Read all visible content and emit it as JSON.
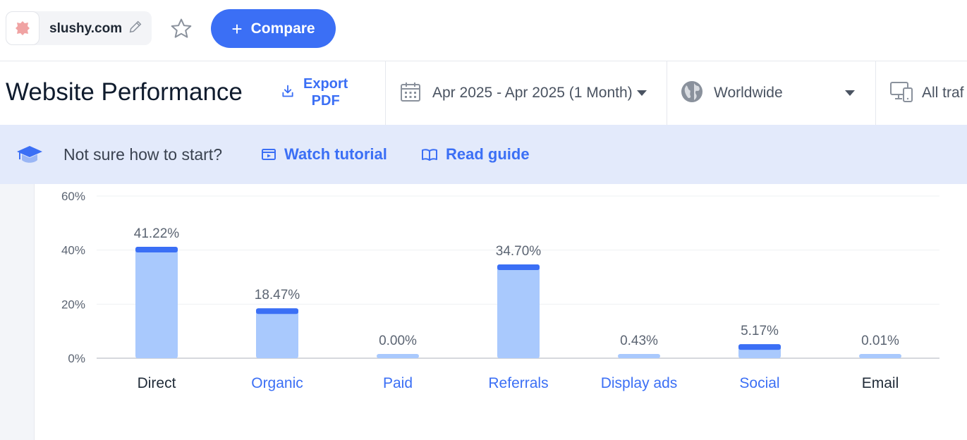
{
  "top": {
    "site": "slushy.com",
    "compare_label": "Compare"
  },
  "header": {
    "title": "Website Performance",
    "export_line1": "Export",
    "export_line2": "PDF",
    "date_range": "Apr 2025 - Apr 2025 (1 Month)",
    "region": "Worldwide",
    "traffic": "All traf"
  },
  "banner": {
    "prompt": "Not sure how to start?",
    "watch": "Watch tutorial",
    "read": "Read guide"
  },
  "colors": {
    "accent": "#3b6ff5",
    "bar_fill": "#a9c9fd",
    "bar_cap": "#3b6ff5"
  },
  "chart_data": {
    "type": "bar",
    "categories": [
      "Direct",
      "Organic",
      "Paid",
      "Referrals",
      "Display ads",
      "Social",
      "Email"
    ],
    "values": [
      41.22,
      18.47,
      0.0,
      34.7,
      0.43,
      5.17,
      0.01
    ],
    "value_labels": [
      "41.22%",
      "18.47%",
      "0.00%",
      "34.70%",
      "0.43%",
      "5.17%",
      "0.01%"
    ],
    "category_link": [
      false,
      true,
      true,
      true,
      true,
      true,
      false
    ],
    "yticks": [
      "0%",
      "20%",
      "40%",
      "60%"
    ],
    "ylim": [
      0,
      60
    ],
    "grid": true
  }
}
